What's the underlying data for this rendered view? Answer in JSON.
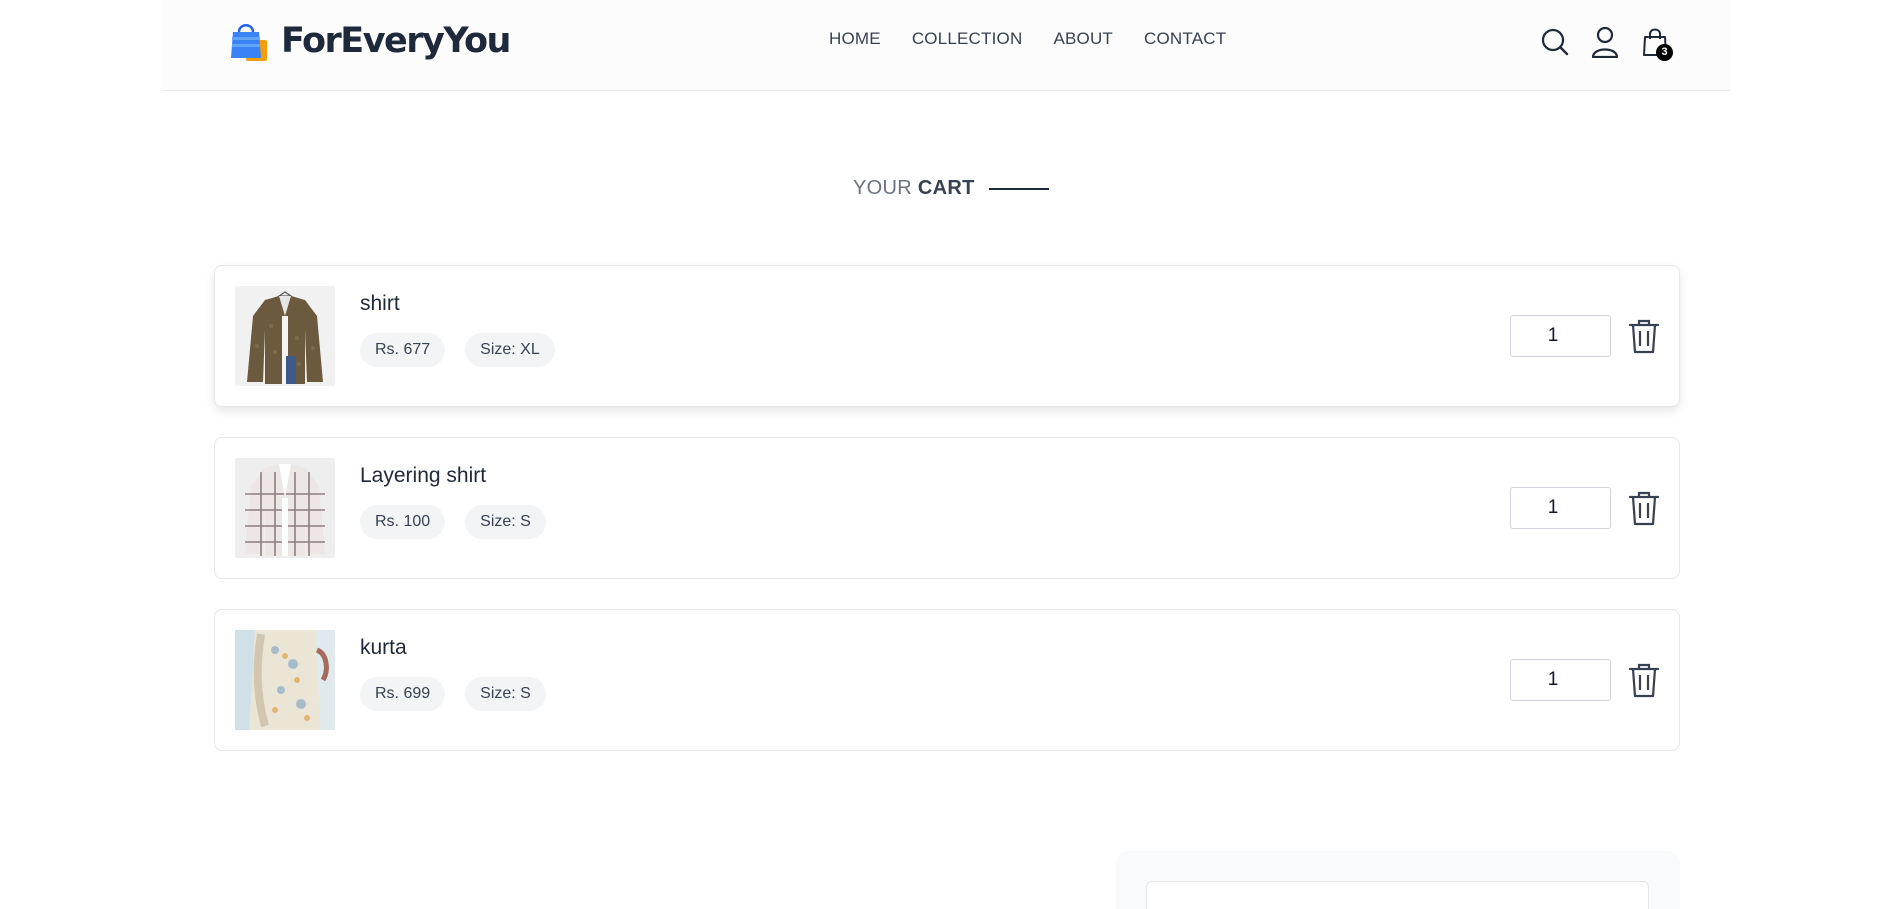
{
  "brand": {
    "name": "ForEveryYou",
    "icon": "shopping-bag-icon"
  },
  "nav": {
    "items": [
      {
        "label": "HOME"
      },
      {
        "label": "COLLECTION"
      },
      {
        "label": "ABOUT"
      },
      {
        "label": "CONTACT"
      }
    ]
  },
  "header_icons": {
    "search": "search-icon",
    "profile": "profile-icon",
    "cart": "cart-icon",
    "cart_count": "3"
  },
  "page_title": {
    "part1": "YOUR",
    "part2": "CART"
  },
  "cart": {
    "items": [
      {
        "name": "shirt",
        "price": "Rs. 677",
        "size": "Size: XL",
        "quantity": "1"
      },
      {
        "name": "Layering shirt",
        "price": "Rs. 100",
        "size": "Size: S",
        "quantity": "1"
      },
      {
        "name": "kurta",
        "price": "Rs. 699",
        "size": "Size: S",
        "quantity": "1"
      }
    ]
  },
  "colors": {
    "brand_blue": "#3b82f6",
    "brand_orange": "#f59e0b",
    "text_dark": "#1e293b",
    "badge_bg": "#000000"
  }
}
